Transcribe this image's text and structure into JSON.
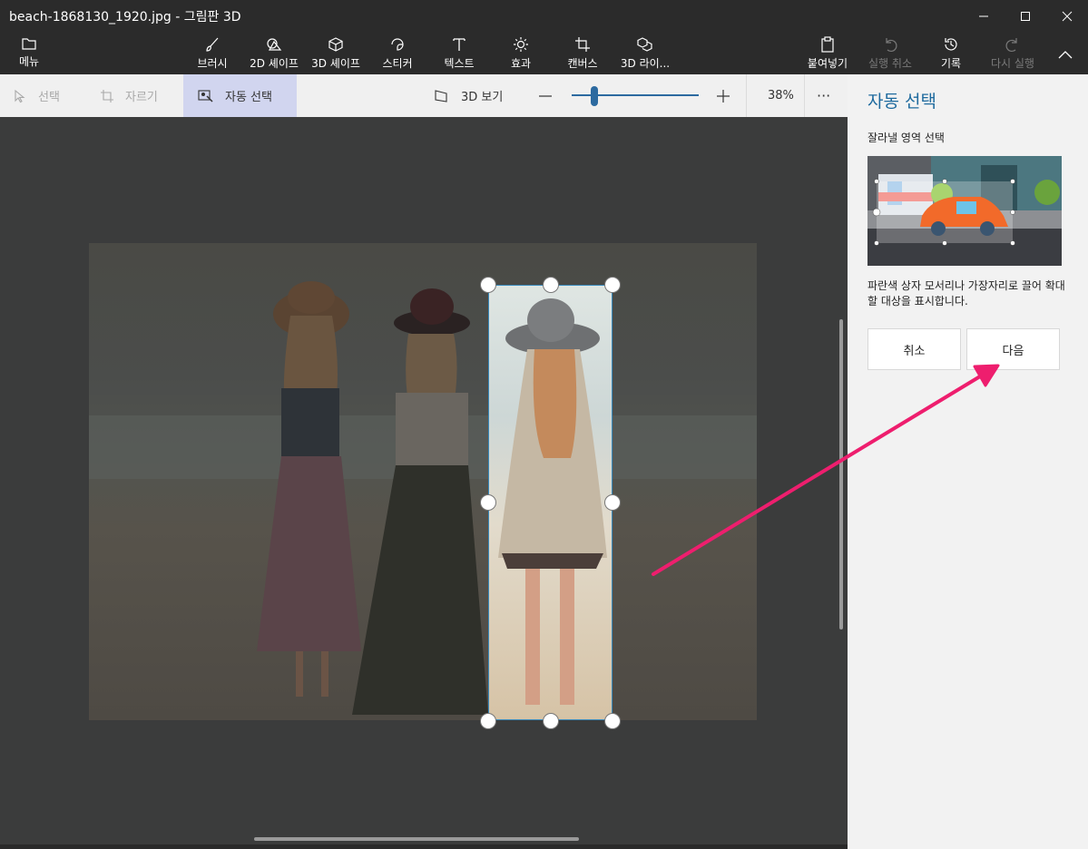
{
  "window": {
    "title": "beach-1868130_1920.jpg - 그림판 3D"
  },
  "ribbon": {
    "menu": "메뉴",
    "brush": "브러시",
    "shapes2d": "2D 셰이프",
    "shapes3d": "3D 셰이프",
    "sticker": "스티커",
    "text": "텍스트",
    "effects": "효과",
    "canvas": "캔버스",
    "library3d": "3D 라이...",
    "paste": "붙여넣기",
    "undo": "실행 취소",
    "history": "기록",
    "redo": "다시 실행"
  },
  "toolbar": {
    "select": "선택",
    "crop": "자르기",
    "magic_select": "자동 선택",
    "view3d": "3D 보기",
    "zoom": "38%",
    "more": "···"
  },
  "panel": {
    "title": "자동 선택",
    "subtitle": "잘라낼 영역 선택",
    "description": "파란색 상자 모서리나 가장자리로 끌어 확대할 대상을 표시합니다.",
    "cancel": "취소",
    "next": "다음"
  },
  "colors": {
    "accent": "#1e6a9e",
    "annotation_arrow": "#ee1e6e",
    "ribbon_bg": "#2b2b2b"
  }
}
